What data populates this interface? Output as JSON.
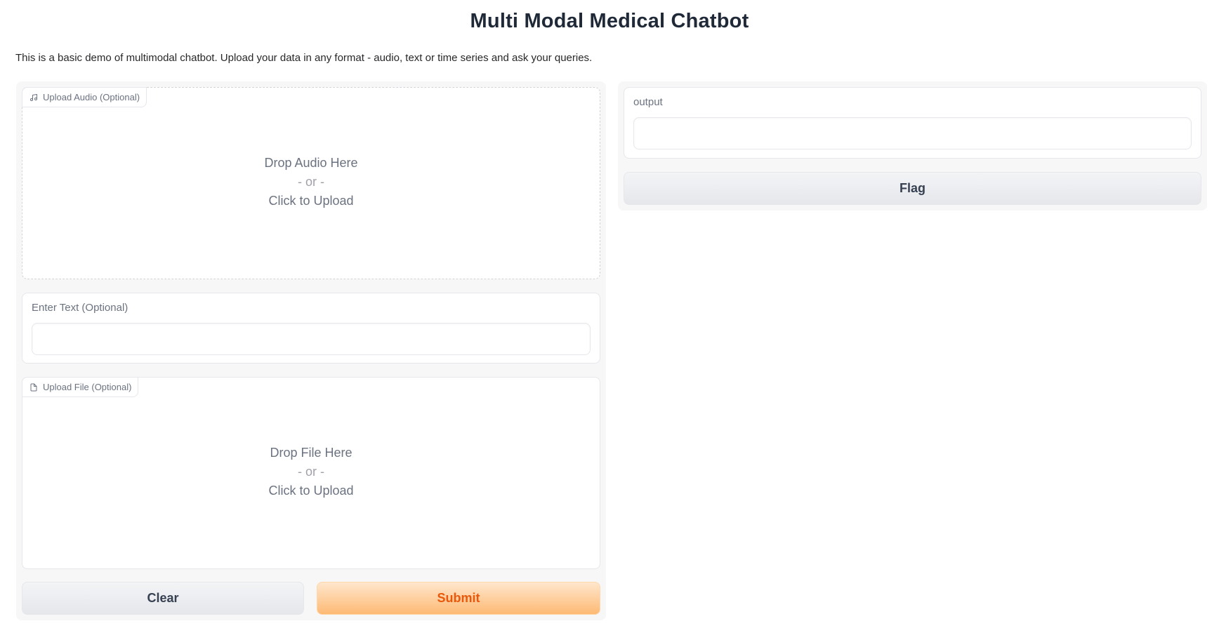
{
  "header": {
    "title": "Multi Modal Medical Chatbot",
    "description": "This is a basic demo of multimodal chatbot. Upload your data in any format - audio, text or time series and ask your queries."
  },
  "inputs": {
    "audio": {
      "label": "Upload Audio (Optional)",
      "icon": "music-note-icon",
      "drop_text": "Drop Audio Here",
      "or_text": "- or -",
      "click_text": "Click to Upload"
    },
    "text": {
      "label": "Enter Text (Optional)",
      "value": "",
      "placeholder": ""
    },
    "file": {
      "label": "Upload File (Optional)",
      "icon": "file-icon",
      "drop_text": "Drop File Here",
      "or_text": "- or -",
      "click_text": "Click to Upload"
    }
  },
  "actions": {
    "clear_label": "Clear",
    "submit_label": "Submit"
  },
  "output": {
    "label": "output",
    "value": "",
    "flag_label": "Flag"
  },
  "colors": {
    "primary_text": "#ea580c",
    "primary_bg_from": "#ffe7cd",
    "primary_bg_to": "#fdba74",
    "panel_bg": "#f7f7f8"
  }
}
